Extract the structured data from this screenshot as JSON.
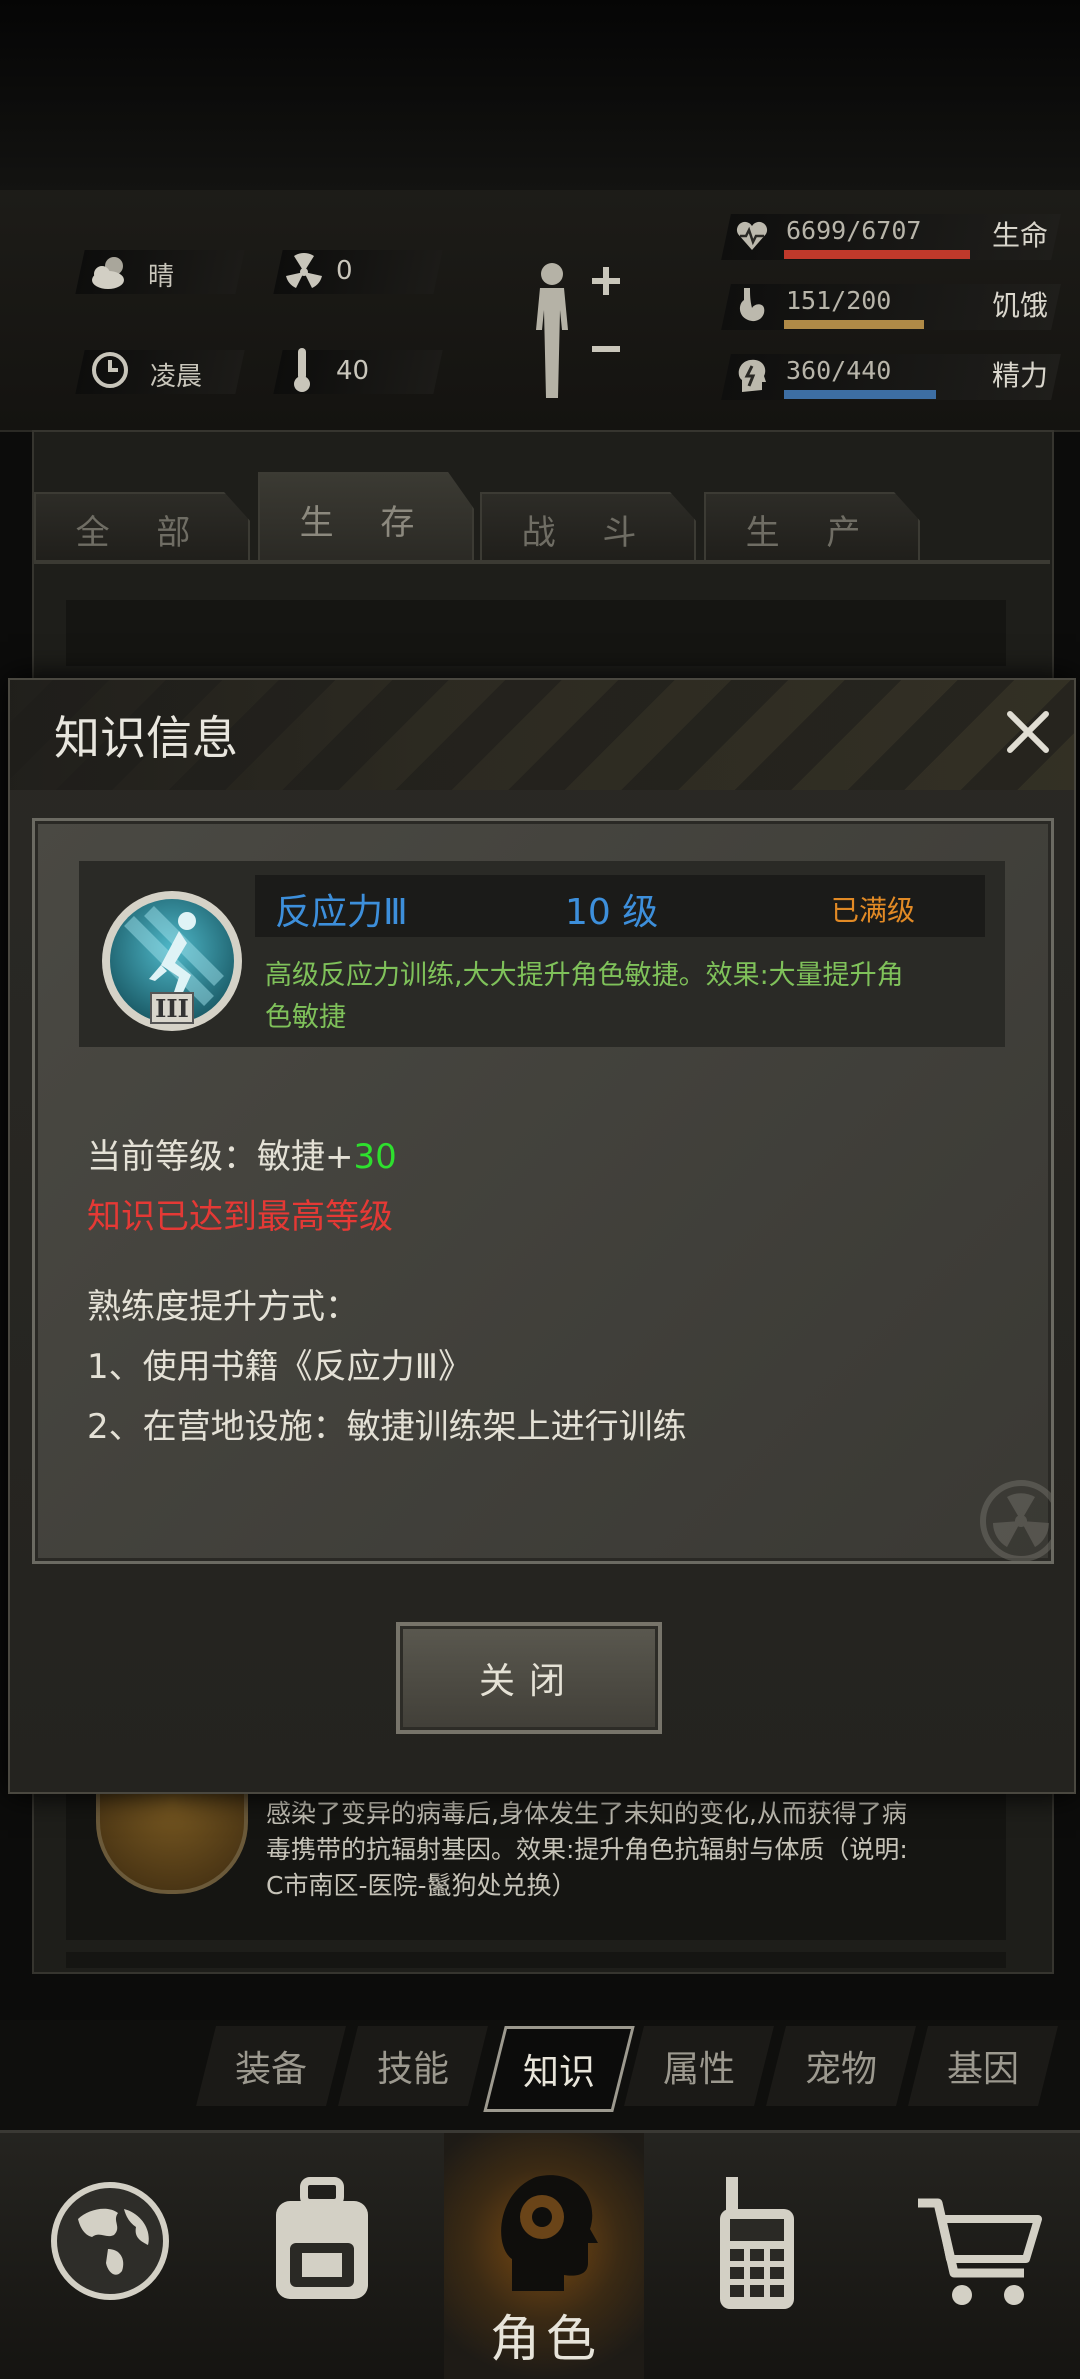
{
  "top": {
    "weather": "晴",
    "radiation": "0",
    "time": "凌晨",
    "temperature": "40",
    "stats": [
      {
        "value": "6699/6707",
        "label": "生命",
        "fraction": 0.999,
        "color": "#c0392b"
      },
      {
        "value": "151/200",
        "label": "饥饿",
        "fraction": 0.755,
        "color": "#b08a47"
      },
      {
        "value": "360/440",
        "label": "精力",
        "fraction": 0.818,
        "color": "#3d6ea3"
      }
    ]
  },
  "tabs": [
    "全 部",
    "生 存",
    "战 斗",
    "生 产"
  ],
  "background_list": {
    "item_desc_line1": "感染了变异的病毒后,身体发生了未知的变化,从而获得了病",
    "item_desc_line2": "毒携带的抗辐射基因。效果:提升角色抗辐射与体质（说明:",
    "item_desc_line3": "C市南区-医院-鬣狗处兑换）"
  },
  "dialog": {
    "title": "知识信息",
    "skill_name": "反应力Ⅲ",
    "skill_level": "10 级",
    "skill_status": "已满级",
    "skill_desc_line1": "高级反应力训练,大大提升角色敏捷。效果:大量提升角",
    "skill_desc_line2": "色敏捷",
    "current_label": "当前等级：敏捷+",
    "current_value": "30",
    "max_notice": "知识已达到最高等级",
    "method_title": "熟练度提升方式：",
    "method_1": "1、使用书籍《反应力Ⅲ》",
    "method_2": "2、在营地设施：敏捷训练架上进行训练",
    "close_button": "关闭"
  },
  "subtabs": [
    "装备",
    "技能",
    "知识",
    "属性",
    "宠物",
    "基因"
  ],
  "active_subtab": "知识",
  "bottom_nav_active_label": "角色",
  "colors": {
    "accent_blue": "#3d8fdb",
    "green": "#7fc15a",
    "orange": "#e28a25",
    "red": "#e53935",
    "bright_green": "#2ee02e"
  }
}
